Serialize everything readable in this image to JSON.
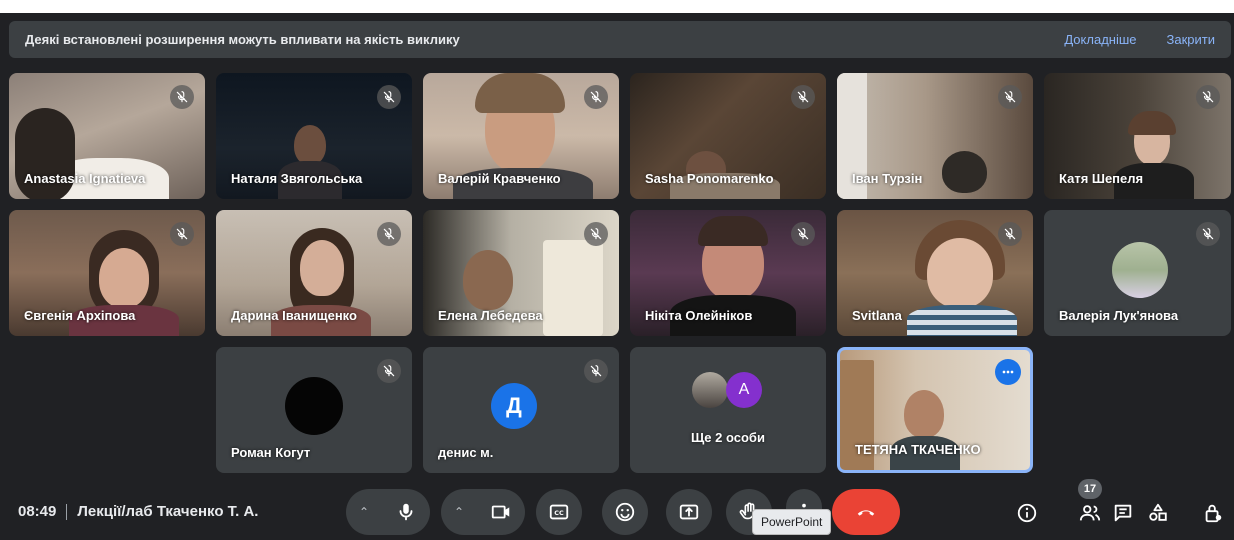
{
  "banner": {
    "message": "Деякі встановлені розширення можуть впливати на якість виклику",
    "learn_more": "Докладніше",
    "close": "Закрити"
  },
  "participants": [
    {
      "name": "Anastasia Ignatieva"
    },
    {
      "name": "Наталя Звягольська"
    },
    {
      "name": "Валерій Кравченко"
    },
    {
      "name": "Sasha Ponomarenko"
    },
    {
      "name": "Іван Турзін"
    },
    {
      "name": "Катя Шепеля"
    },
    {
      "name": "Євгенія Архіпова"
    },
    {
      "name": "Дарина Іванищенко"
    },
    {
      "name": "Елена Лебедева"
    },
    {
      "name": "Нікіта Олейніков"
    },
    {
      "name": "Svitlana"
    },
    {
      "name": "Валерія Лук'янова"
    },
    {
      "name": "Роман Когут"
    },
    {
      "name": "денис м.",
      "initial": "Д",
      "color": "#1a73e8"
    },
    {
      "name": "Ще 2 особи",
      "initial": "А",
      "color": "#8430ce"
    },
    {
      "name": "ТЕТЯНА ТКАЧЕНКО"
    }
  ],
  "meeting": {
    "time": "08:49",
    "title": "Лекції/лаб Ткаченко Т. А."
  },
  "tooltip": "PowerPoint",
  "people_count": "17",
  "colors": {
    "accent": "#8ab4f8",
    "hangup": "#ea4335",
    "tile_bg": "#3c4043"
  }
}
